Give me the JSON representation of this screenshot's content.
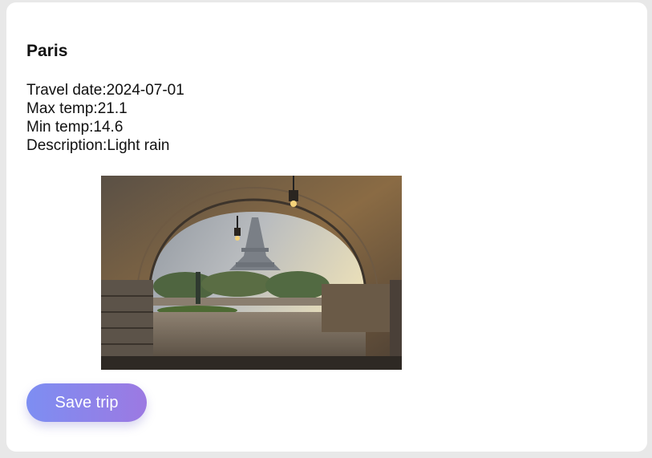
{
  "trip": {
    "city": "Paris",
    "travel_date_label": "Travel date:",
    "travel_date": "2024-07-01",
    "max_temp_label": "Max temp:",
    "max_temp": "21.1",
    "min_temp_label": "Min temp:",
    "min_temp": "14.6",
    "description_label": "Description:",
    "description": "Light rain"
  },
  "actions": {
    "save_label": "Save trip"
  },
  "colors": {
    "button_gradient_start": "#7d8ef2",
    "button_gradient_end": "#9c79e2"
  }
}
